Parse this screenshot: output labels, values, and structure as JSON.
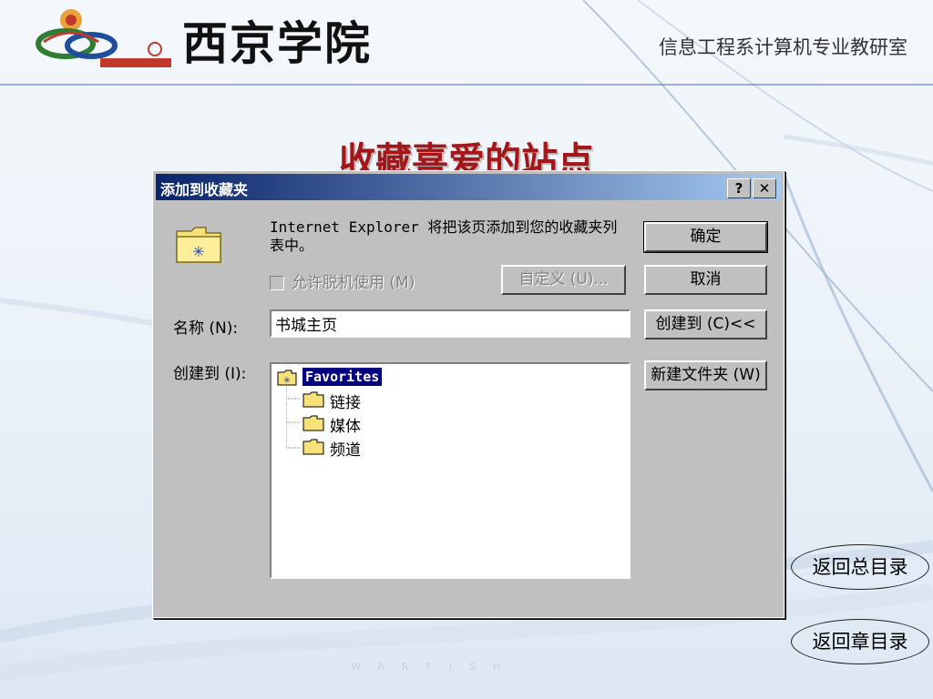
{
  "header": {
    "logo_title": "西京学院",
    "department": "信息工程系计算机专业教研室"
  },
  "slide": {
    "title": "收藏喜爱的站点"
  },
  "dialog": {
    "title": "添加到收藏夹",
    "message": "Internet Explorer 将把该页添加到您的收藏夹列表中。",
    "offline_checkbox_label": "允许脱机使用 (M)",
    "offline_checked": false,
    "customize_label": "自定义 (U)...",
    "ok_label": "确定",
    "cancel_label": "取消",
    "create_in_button_label": "创建到 (C)<<",
    "new_folder_label": "新建文件夹 (W)",
    "name_label": "名称 (N):",
    "name_value": "书城主页",
    "create_in_label": "创建到 (I):",
    "tree": {
      "root": "Favorites",
      "items": [
        "链接",
        "媒体",
        "频道"
      ]
    }
  },
  "nav": {
    "toc_label": "返回总目录",
    "chapter_label": "返回章目录"
  },
  "watermark": "WARFISH",
  "colors": {
    "title_red": "#a4161a",
    "titlebar_start": "#0a246a",
    "titlebar_end": "#a6caf0",
    "window_gray": "#c0c0c0",
    "selection": "#000080"
  },
  "icons": {
    "folder": "folder-icon",
    "help": "question-icon",
    "close": "close-icon"
  }
}
